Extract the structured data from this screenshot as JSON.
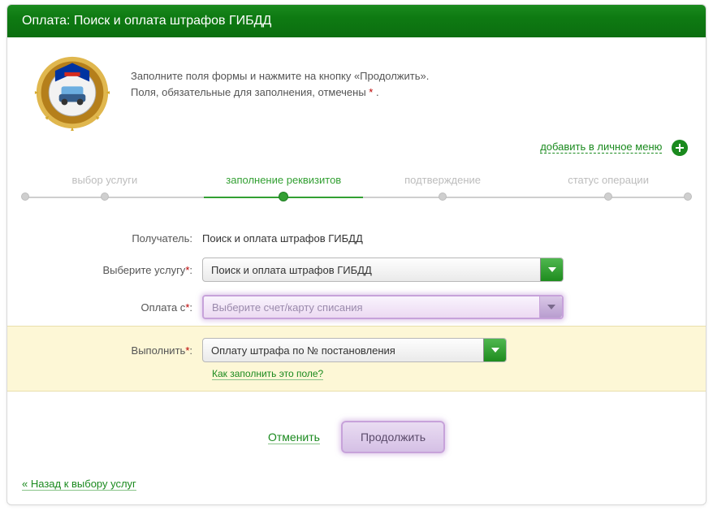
{
  "header": {
    "title": "Оплата: Поиск и оплата штрафов ГИБДД"
  },
  "intro": {
    "line1": "Заполните поля формы и нажмите на кнопку «Продолжить».",
    "line2_prefix": "Поля, обязательные для заполнения, отмечены ",
    "line2_marker": "*",
    "line2_suffix": " ."
  },
  "favorite": {
    "label": "добавить в личное меню"
  },
  "wizard": {
    "steps": [
      {
        "label": "выбор услуги",
        "active": false,
        "pos_pct": 12
      },
      {
        "label": "заполнение реквизитов",
        "active": true,
        "pos_pct": 39
      },
      {
        "label": "подтверждение",
        "active": false,
        "pos_pct": 63
      },
      {
        "label": "статус операции",
        "active": false,
        "pos_pct": 88
      }
    ],
    "active_segment": {
      "from_pct": 27,
      "to_pct": 51
    }
  },
  "fields": {
    "recipient": {
      "label": "Получатель:",
      "value": "Поиск и оплата штрафов ГИБДД"
    },
    "service": {
      "label": "Выберите услугу",
      "selected": "Поиск и оплата штрафов ГИБДД"
    },
    "payFrom": {
      "label": "Оплата с",
      "placeholder": "Выберите счет/карту списания"
    },
    "perform": {
      "label": "Выполнить",
      "selected": "Оплату штрафа по № постановления",
      "help": "Как заполнить это поле?"
    }
  },
  "actions": {
    "cancel": "Отменить",
    "continue": "Продолжить"
  },
  "backLink": "« Назад к выбору услуг"
}
